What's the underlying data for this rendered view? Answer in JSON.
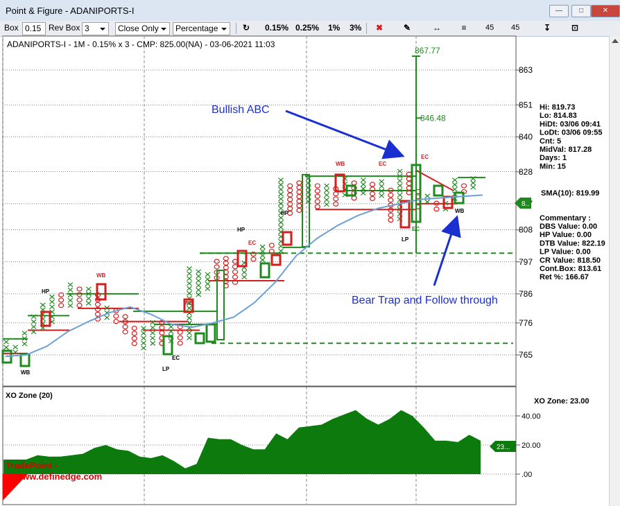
{
  "window": {
    "title": "Point & Figure - ADANIPORTS-I"
  },
  "toolbar": {
    "box_label": "Box",
    "box_value": "0.15",
    "rev_box_label": "Rev Box",
    "rev_box_value": "3",
    "close_mode": "Close Only",
    "scale_mode": "Percentage",
    "pct_buttons": [
      "0.15%",
      "0.25%",
      "1%",
      "3%"
    ],
    "angle_left": "45",
    "angle_right": "45"
  },
  "chart_data": {
    "type": "point-and-figure",
    "header": "ADANIPORTS-I - 1M - 0.15% x 3 - CMP: 825.00(NA) - 03-06-2021 11:03",
    "y_ticks": [
      863,
      851,
      840,
      828,
      817,
      808,
      797,
      786,
      776,
      765
    ],
    "ylim": [
      756,
      868
    ],
    "grid": true,
    "columns": [
      {
        "kind": "X",
        "low": 766.5,
        "high": 770.3,
        "color": "green"
      },
      {
        "kind": "X",
        "low": 765.0,
        "high": 768.5,
        "color": "green"
      },
      {
        "kind": "X",
        "low": 767.8,
        "high": 773.3,
        "color": "green"
      },
      {
        "kind": "X",
        "low": 772.0,
        "high": 779.0,
        "color": "green"
      },
      {
        "kind": "X",
        "low": 773.5,
        "high": 783.0,
        "color": "green"
      },
      {
        "kind": "X",
        "low": 775.5,
        "high": 785.8,
        "color": "green"
      },
      {
        "kind": "O",
        "low": 781.0,
        "high": 786.5,
        "color": "red"
      },
      {
        "kind": "X",
        "low": 781.0,
        "high": 790.0,
        "color": "green"
      },
      {
        "kind": "O",
        "low": 781.0,
        "high": 788.5,
        "color": "red"
      },
      {
        "kind": "X",
        "low": 782.0,
        "high": 788.5,
        "color": "green"
      },
      {
        "kind": "O",
        "low": 776.5,
        "high": 786.5,
        "color": "red"
      },
      {
        "kind": "X",
        "low": 777.0,
        "high": 782.0,
        "color": "green"
      },
      {
        "kind": "O",
        "low": 775.5,
        "high": 781.0,
        "color": "red"
      },
      {
        "kind": "O",
        "low": 772.0,
        "high": 779.0,
        "color": "red"
      },
      {
        "kind": "O",
        "low": 768.0,
        "high": 775.0,
        "color": "red"
      },
      {
        "kind": "X",
        "low": 766.5,
        "high": 775.0,
        "color": "green"
      },
      {
        "kind": "X",
        "low": 768.0,
        "high": 777.0,
        "color": "green"
      },
      {
        "kind": "O",
        "low": 768.0,
        "high": 777.0,
        "color": "red"
      },
      {
        "kind": "X",
        "low": 769.0,
        "high": 775.5,
        "color": "green"
      },
      {
        "kind": "O",
        "low": 768.0,
        "high": 775.5,
        "color": "red"
      },
      {
        "kind": "X",
        "low": 770.0,
        "high": 795.5,
        "color": "green"
      },
      {
        "kind": "X",
        "low": 785.0,
        "high": 794.5,
        "color": "green"
      },
      {
        "kind": "X",
        "low": 787.0,
        "high": 793.5,
        "color": "green"
      },
      {
        "kind": "O",
        "low": 790.5,
        "high": 798.0,
        "color": "red"
      },
      {
        "kind": "O",
        "low": 788.0,
        "high": 799.0,
        "color": "red"
      },
      {
        "kind": "O",
        "low": 789.0,
        "high": 798.0,
        "color": "red"
      },
      {
        "kind": "X",
        "low": 791.0,
        "high": 797.5,
        "color": "green"
      },
      {
        "kind": "O",
        "low": 797.0,
        "high": 800.5,
        "color": "red"
      },
      {
        "kind": "X",
        "low": 797.0,
        "high": 803.0,
        "color": "green"
      },
      {
        "kind": "O",
        "low": 799.5,
        "high": 803.5,
        "color": "red"
      },
      {
        "kind": "X",
        "low": 800.0,
        "high": 826.0,
        "color": "green"
      },
      {
        "kind": "O",
        "low": 813.0,
        "high": 824.0,
        "color": "red"
      },
      {
        "kind": "O",
        "low": 814.0,
        "high": 825.0,
        "color": "red"
      },
      {
        "kind": "X",
        "low": 817.0,
        "high": 826.5,
        "color": "green"
      },
      {
        "kind": "O",
        "low": 815.0,
        "high": 824.0,
        "color": "red"
      },
      {
        "kind": "X",
        "low": 816.0,
        "high": 824.0,
        "color": "green"
      },
      {
        "kind": "O",
        "low": 816.0,
        "high": 823.0,
        "color": "red"
      },
      {
        "kind": "X",
        "low": 819.0,
        "high": 826.5,
        "color": "green"
      },
      {
        "kind": "O",
        "low": 818.0,
        "high": 825.0,
        "color": "red"
      },
      {
        "kind": "X",
        "low": 820.0,
        "high": 826.0,
        "color": "green"
      },
      {
        "kind": "O",
        "low": 818.0,
        "high": 824.5,
        "color": "red"
      },
      {
        "kind": "X",
        "low": 819.0,
        "high": 825.5,
        "color": "green"
      },
      {
        "kind": "O",
        "low": 810.5,
        "high": 822.5,
        "color": "red"
      },
      {
        "kind": "X",
        "low": 811.0,
        "high": 829.0,
        "color": "green"
      },
      {
        "kind": "O",
        "low": 820.0,
        "high": 828.0,
        "color": "red"
      },
      {
        "kind": "O",
        "low": 815.0,
        "high": 822.0,
        "color": "red"
      },
      {
        "kind": "X",
        "low": 816.5,
        "high": 820.5,
        "color": "green"
      },
      {
        "kind": "O",
        "low": 814.0,
        "high": 818.0,
        "color": "red"
      },
      {
        "kind": "X",
        "low": 814.0,
        "high": 818.0,
        "color": "green"
      },
      {
        "kind": "X",
        "low": 818.0,
        "high": 826.0,
        "color": "green"
      },
      {
        "kind": "O",
        "low": 820.0,
        "high": 824.0,
        "color": "red"
      },
      {
        "kind": "X",
        "low": 822.0,
        "high": 826.5,
        "color": "green"
      }
    ],
    "sma_label": "SMA(10): 819.99",
    "sma_values": [
      764.5,
      765.0,
      768.0,
      773.0,
      776.5,
      779.5,
      781.5,
      779.0,
      775.5,
      774.5,
      776.0,
      778.0,
      783.0,
      790.0,
      799.0,
      805.0,
      809.5,
      813.0,
      815.5,
      817.0,
      818.5,
      819.0,
      819.5,
      819.99
    ],
    "spike": {
      "high": 867.77,
      "mid": 846.48,
      "low": 800.0
    },
    "dashed_levels": [
      800.0,
      769.0
    ],
    "annotations": [
      {
        "text": "Bullish ABC",
        "color": "#1a2fd0"
      },
      {
        "text": "Bear Trap and Follow through",
        "color": "#1a2fd0"
      }
    ],
    "markers": [
      "WB",
      "HP",
      "WB",
      "WB",
      "LP",
      "EC",
      "HP",
      "EC",
      "HP",
      "WB",
      "EC",
      "LP",
      "EC",
      "EC",
      "WB"
    ],
    "stats": [
      "Hi: 819.73",
      "Lo: 814.83",
      "HiDt: 03/06 09:41",
      "LoDt: 03/06 09:55",
      "Cnt: 5",
      "MidVal: 817.28",
      "Days: 1",
      "Min: 15"
    ],
    "commentary_title": "Commentary :",
    "commentary": [
      "DBS Value:  0.00",
      "HP Value: 0.00",
      "DTB Value: 822.19",
      "LP Value: 0.00",
      "CR Value:  818.50",
      "Cont.Box: 813.61",
      "Ret %: 166.67"
    ],
    "price_tag": "8..",
    "xo_zone": {
      "title": "XO Zone (20)",
      "value_label": "XO Zone: 23.00",
      "y_ticks": [
        "40.00",
        "20.00",
        ".00"
      ],
      "ylim": [
        -8,
        50
      ],
      "values": [
        10,
        10,
        10,
        13,
        12,
        12,
        13,
        14,
        18,
        20,
        17,
        16,
        12,
        11,
        13,
        9,
        4,
        7,
        25,
        24,
        24,
        20,
        17,
        17,
        28,
        24,
        32,
        33,
        34,
        38,
        41,
        44,
        38,
        34,
        38,
        44,
        40,
        32,
        23,
        23,
        22,
        27,
        23
      ],
      "tag": "23...",
      "brand": "TradePoint -",
      "website": "www.definedge.com"
    }
  },
  "colors": {
    "x_green": "#1e8a1e",
    "o_red": "#d21e1e",
    "sma": "#6b9fd8",
    "zone_fill": "#0c7a0c",
    "annotation": "#1a2fd0"
  }
}
